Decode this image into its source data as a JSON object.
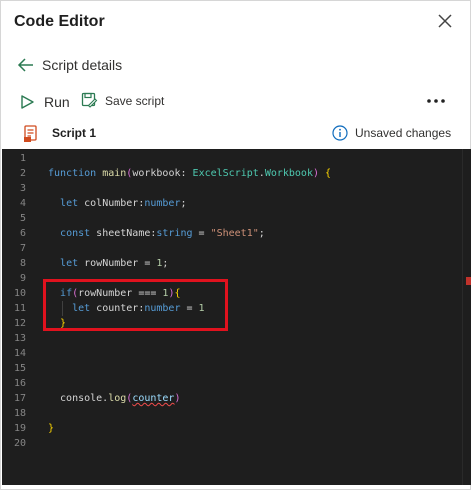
{
  "panel": {
    "title": "Code Editor"
  },
  "nav": {
    "back_label": "Script details"
  },
  "toolbar": {
    "run_label": "Run",
    "save_label": "Save script"
  },
  "script": {
    "name": "Script 1",
    "status": "Unsaved changes"
  },
  "editor": {
    "line_numbers": [
      "1",
      "2",
      "3",
      "4",
      "5",
      "6",
      "7",
      "8",
      "9",
      "10",
      "11",
      "12",
      "13",
      "14",
      "15",
      "16",
      "17",
      "18",
      "19",
      "20"
    ],
    "lines": [
      "",
      "function main(workbook: ExcelScript.Workbook) {",
      "",
      "  let colNumber:number;",
      "",
      "  const sheetName:string = \"Sheet1\";",
      "",
      "  let rowNumber = 1;",
      "",
      "  if(rowNumber === 1){",
      "    let counter:number = 1",
      "  }",
      "",
      "",
      "",
      "",
      "  console.log(counter)",
      "",
      "}",
      ""
    ]
  },
  "colors": {
    "editor_background": "#1e1e1e",
    "highlight_border": "#e0121e",
    "keyword": "#569cd6",
    "type": "#4ec9b0",
    "string": "#ce9178"
  }
}
